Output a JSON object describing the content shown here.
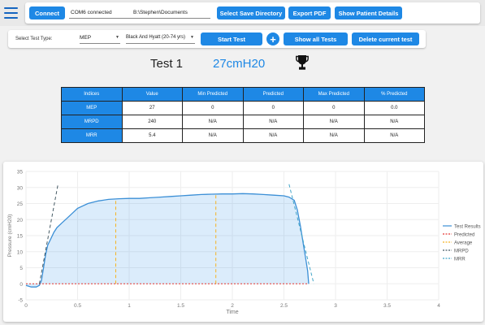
{
  "toolbar": {
    "connect_label": "Connect",
    "port_value": "COM6 connected",
    "directory_value": "B:\\Stephen\\Documents",
    "select_dir_label": "Select Save Directory",
    "export_pdf_label": "Export PDF",
    "show_patient_label": "Show Patient Details"
  },
  "test_controls": {
    "type_label": "Select Test Type:",
    "test_type": "MEP",
    "reference": "Black And Hyatt (20-74 yrs)",
    "start_label": "Start Test",
    "show_all_label": "Show all Tests",
    "delete_label": "Delete current test"
  },
  "test": {
    "title": "Test 1",
    "value": "27cmH20"
  },
  "results": {
    "headers": [
      "Indices",
      "Value",
      "Min Predicted",
      "Predicted",
      "Max Predicted",
      "% Predicted"
    ],
    "rows": [
      [
        "MEP",
        "27",
        "0",
        "0",
        "0",
        "0.0"
      ],
      [
        "MRPD",
        "240",
        "N/A",
        "N/A",
        "N/A",
        "N/A"
      ],
      [
        "MRR",
        "5.4",
        "N/A",
        "N/A",
        "N/A",
        "N/A"
      ]
    ]
  },
  "chart_data": {
    "type": "line",
    "xlabel": "Time",
    "ylabel": "Pressure (cmH20)",
    "xlim": [
      0,
      4
    ],
    "ylim": [
      -5,
      35
    ],
    "xticks": [
      "0",
      "0.5",
      "1",
      "1.5",
      "2",
      "2.5",
      "3",
      "3.5",
      "4"
    ],
    "yticks": [
      "-5",
      "0",
      "5",
      "10",
      "15",
      "20",
      "25",
      "30",
      "35"
    ],
    "legend_position": "right",
    "grid": true,
    "series": [
      {
        "name": "Test Results",
        "color": "#3b8fd6",
        "fill": true,
        "x": [
          0.0,
          0.05,
          0.1,
          0.13,
          0.15,
          0.17,
          0.19,
          0.21,
          0.24,
          0.27,
          0.3,
          0.35,
          0.4,
          0.45,
          0.5,
          0.6,
          0.7,
          0.8,
          0.9,
          1.0,
          1.1,
          1.2,
          1.3,
          1.4,
          1.5,
          1.6,
          1.7,
          1.8,
          1.9,
          2.0,
          2.1,
          2.2,
          2.3,
          2.4,
          2.5,
          2.55,
          2.6,
          2.63,
          2.66,
          2.69,
          2.71,
          2.73,
          2.74
        ],
        "y": [
          -0.5,
          -1.0,
          -1.0,
          -0.5,
          1.0,
          5.0,
          9.0,
          12.0,
          14.0,
          16.0,
          17.5,
          19.0,
          20.5,
          22.0,
          23.5,
          25.0,
          25.8,
          26.3,
          26.5,
          26.6,
          26.6,
          26.8,
          27.0,
          27.2,
          27.4,
          27.6,
          27.8,
          27.9,
          28.0,
          28.0,
          28.1,
          28.0,
          27.8,
          27.6,
          27.4,
          27.0,
          26.0,
          23.0,
          18.0,
          12.0,
          8.0,
          4.0,
          0.0
        ]
      },
      {
        "name": "Predicted",
        "color": "#e53935",
        "dash": "2,2",
        "x": [
          0.0,
          2.74
        ],
        "y": [
          0.0,
          0.0
        ]
      },
      {
        "name": "Average",
        "color": "#f5b324",
        "dash": "4,3",
        "segments": [
          {
            "x": [
              0.87,
              0.87
            ],
            "y": [
              0.0,
              26.5
            ]
          },
          {
            "x": [
              1.84,
              1.84
            ],
            "y": [
              0.0,
              28.0
            ]
          }
        ]
      },
      {
        "name": "MRPD",
        "color": "#455a64",
        "dash": "4,3",
        "x": [
          0.13,
          0.31
        ],
        "y": [
          0.0,
          31.0
        ]
      },
      {
        "name": "MRR",
        "color": "#42a5c8",
        "dash": "4,3",
        "x": [
          2.55,
          2.79
        ],
        "y": [
          31.0,
          0.0
        ]
      }
    ]
  }
}
